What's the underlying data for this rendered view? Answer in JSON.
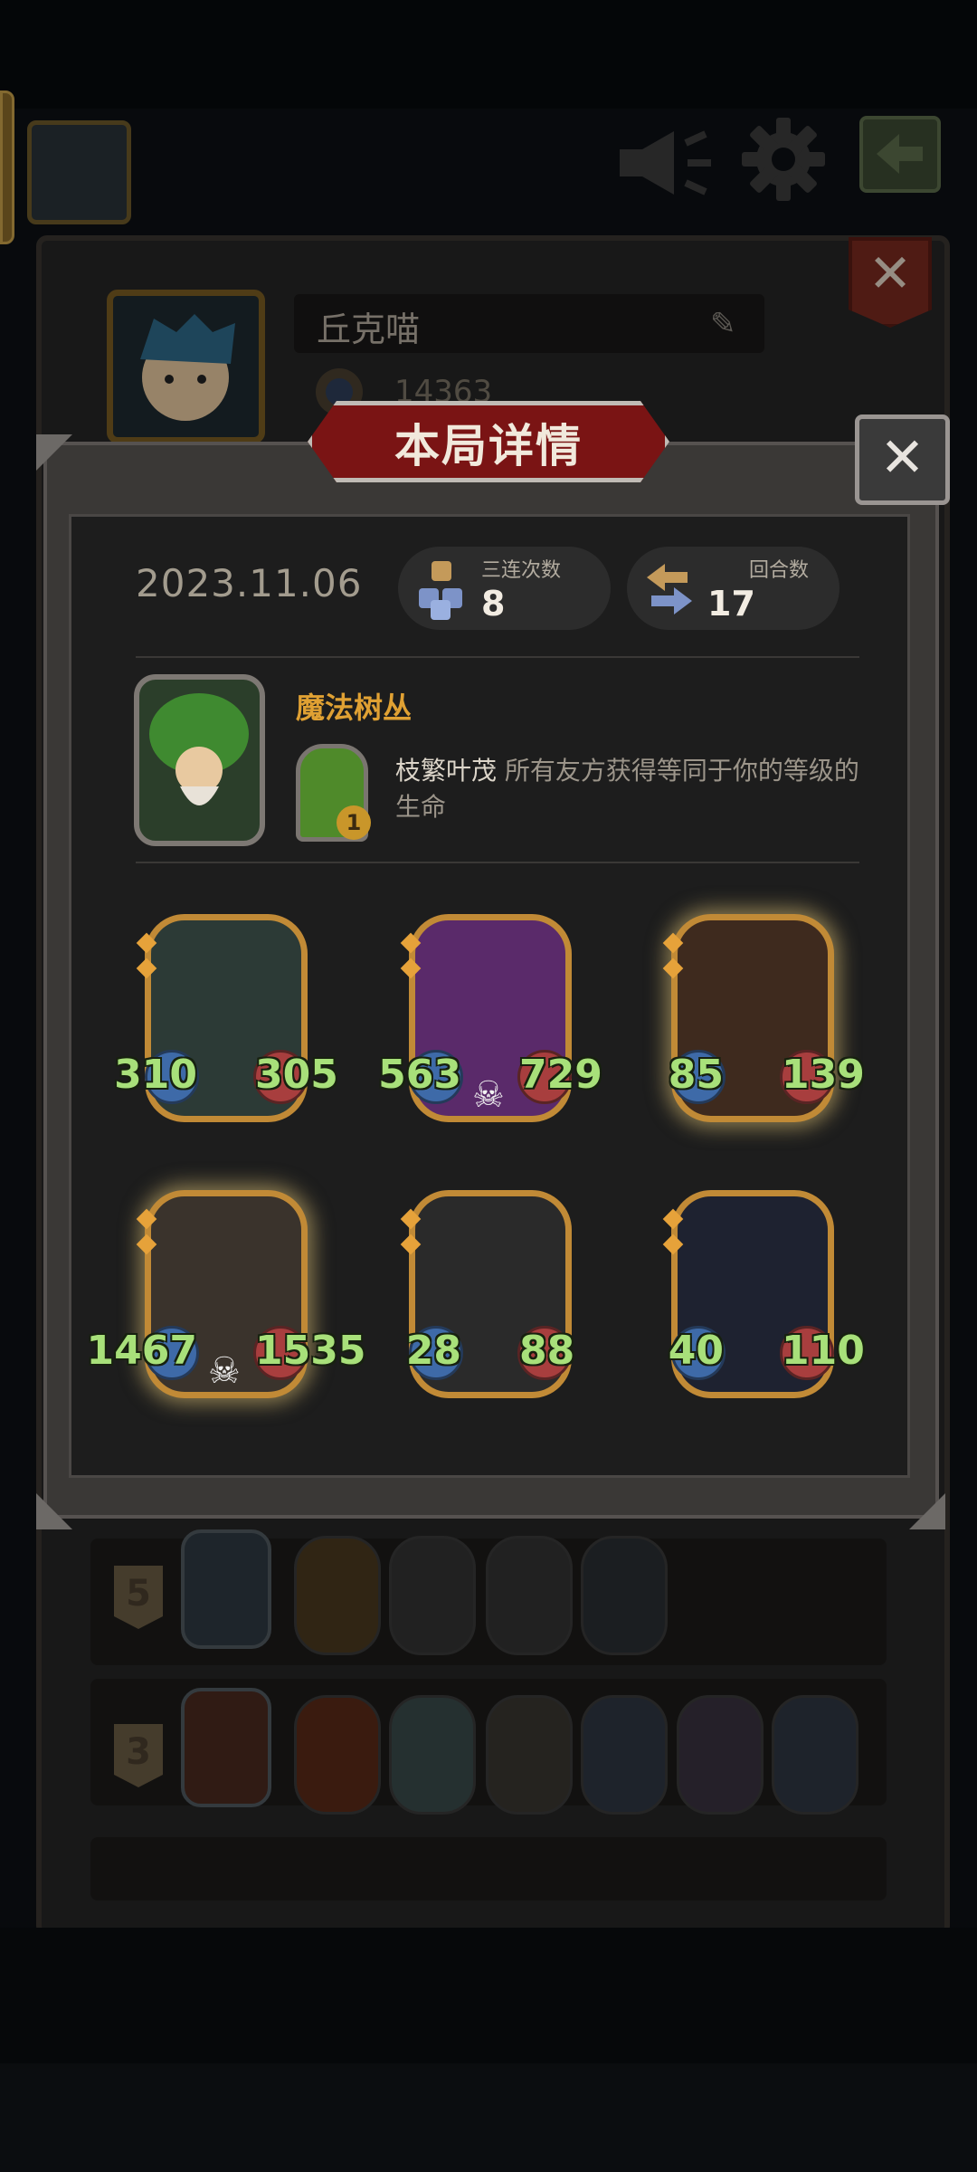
{
  "header": {
    "icons": [
      "megaphone-icon",
      "gear-icon",
      "exit-icon"
    ]
  },
  "profile": {
    "name": "丘克喵",
    "score": "14363"
  },
  "modal": {
    "title": "本局详情",
    "date": "2023.11.06",
    "stats": {
      "triples_label": "三连次数",
      "triples_value": "8",
      "turns_label": "回合数",
      "turns_value": "17"
    },
    "hero": {
      "name": "魔法树丛",
      "power_level": "1",
      "power_name": "枝繁叶茂",
      "power_desc": " 所有友方获得等同于你的等级的生命"
    },
    "minions": [
      {
        "attack": "310",
        "health": "305",
        "golden": false,
        "deathrattle": false,
        "color": "#2c3a36"
      },
      {
        "attack": "563",
        "health": "729",
        "golden": false,
        "deathrattle": true,
        "color": "#5a2a6a"
      },
      {
        "attack": "85",
        "health": "139",
        "golden": true,
        "deathrattle": false,
        "color": "#3e2a1e"
      },
      {
        "attack": "1467",
        "health": "1535",
        "golden": true,
        "deathrattle": true,
        "color": "#3a332c"
      },
      {
        "attack": "28",
        "health": "88",
        "golden": false,
        "deathrattle": false,
        "color": "#2a2a2a"
      },
      {
        "attack": "40",
        "health": "110",
        "golden": false,
        "deathrattle": false,
        "color": "#1e2230"
      }
    ]
  },
  "history": [
    {
      "rank": "5"
    },
    {
      "rank": "3"
    }
  ],
  "colors": {
    "accent_gold": "#e0a133",
    "stat_green": "#a8e07a",
    "banner_red": "#7a1414"
  }
}
